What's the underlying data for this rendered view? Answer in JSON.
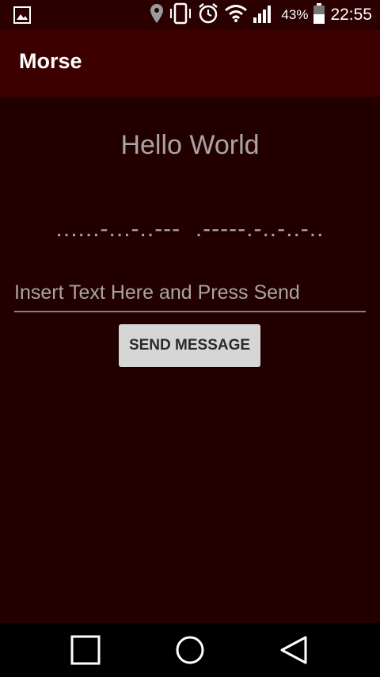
{
  "status_bar": {
    "battery_percent": "43%",
    "time": "22:55",
    "icons": [
      "gallery-icon",
      "location-icon",
      "vibrate-icon",
      "alarm-icon",
      "wifi-icon",
      "signal-icon",
      "battery-icon"
    ]
  },
  "app_bar": {
    "title": "Morse"
  },
  "main": {
    "heading": "Hello World",
    "morse_output": "......-...-..---  .-----.-..-..-..",
    "input_placeholder": "Insert Text Here and Press Send",
    "input_value": "",
    "send_button_label": "SEND MESSAGE"
  },
  "nav_bar": {
    "icons": [
      "recent-apps-icon",
      "home-icon",
      "back-icon"
    ]
  },
  "colors": {
    "status_bar": "#2a0000",
    "app_bar": "#3d0000",
    "background": "#230000",
    "text": "#a9a4a4",
    "button": "#d6d6d6"
  }
}
